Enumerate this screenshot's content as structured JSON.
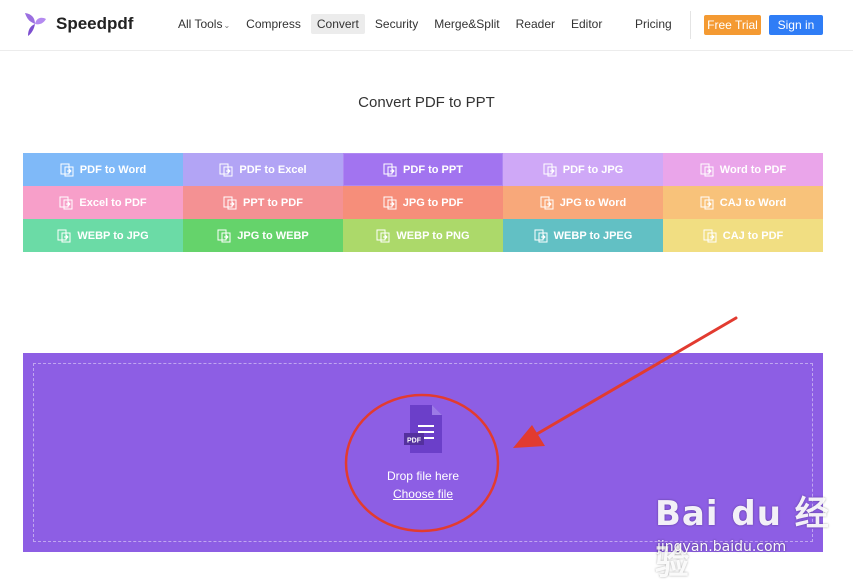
{
  "header": {
    "logo_text": "Speedpdf",
    "nav": [
      {
        "label": "All Tools",
        "has_dropdown": true,
        "active": false
      },
      {
        "label": "Compress",
        "active": false
      },
      {
        "label": "Convert",
        "active": true
      },
      {
        "label": "Security",
        "active": false
      },
      {
        "label": "Merge&Split",
        "active": false
      },
      {
        "label": "Reader",
        "active": false
      },
      {
        "label": "Editor",
        "active": false
      }
    ],
    "pricing_label": "Pricing",
    "free_trial_label": "Free Trial",
    "sign_in_label": "Sign in"
  },
  "page_title": "Convert PDF to PPT",
  "tools": [
    {
      "label": "PDF to Word",
      "color": "#7fb9f8",
      "active": false
    },
    {
      "label": "PDF to Excel",
      "color": "#b2a4f5",
      "active": false
    },
    {
      "label": "PDF to PPT",
      "color": "#a274f0",
      "active": true
    },
    {
      "label": "PDF to JPG",
      "color": "#cfa8f7",
      "active": false
    },
    {
      "label": "Word to PDF",
      "color": "#eaa5ea",
      "active": false
    },
    {
      "label": "Excel to PDF",
      "color": "#f79fc9",
      "active": false
    },
    {
      "label": "PPT to PDF",
      "color": "#f49193",
      "active": false
    },
    {
      "label": "JPG to PDF",
      "color": "#f68e7a",
      "active": false
    },
    {
      "label": "JPG to Word",
      "color": "#f8a87a",
      "active": false
    },
    {
      "label": "CAJ to Word",
      "color": "#f8c27a",
      "active": false
    },
    {
      "label": "WEBP to JPG",
      "color": "#6bdba6",
      "active": false
    },
    {
      "label": "JPG to WEBP",
      "color": "#65d36b",
      "active": false
    },
    {
      "label": "WEBP to PNG",
      "color": "#acd96a",
      "active": false
    },
    {
      "label": "WEBP to JPEG",
      "color": "#62c0c4",
      "active": false
    },
    {
      "label": "CAJ to PDF",
      "color": "#f1de82",
      "active": false
    }
  ],
  "dropzone": {
    "icon_label": "PDF",
    "drop_text": "Drop file here",
    "choose_label": "Choose file",
    "background": "#8d5ee4"
  },
  "watermark": {
    "brand": "Bai du 经验",
    "url": "jingyan.baidu.com"
  },
  "colors": {
    "accent_purple": "#8d5ee4",
    "free_trial": "#f49a32",
    "sign_in": "#2f7df6",
    "annotation_red": "#e23b30"
  }
}
